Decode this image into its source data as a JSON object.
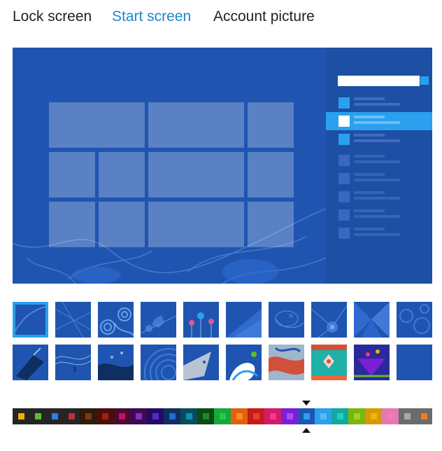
{
  "tabs": [
    {
      "label": "Lock screen",
      "active": false
    },
    {
      "label": "Start screen",
      "active": true
    },
    {
      "label": "Account picture",
      "active": false
    }
  ],
  "colors": {
    "accent": "#1e87c8",
    "background": "#1f55b0",
    "charm_bar": "#1d4fa4",
    "highlight": "#2aa0ee"
  },
  "patterns": {
    "selected_index": 0,
    "count": 20
  },
  "color_swatches": [
    {
      "bg": "#252525",
      "dot": "#f0b000"
    },
    {
      "bg": "#252525",
      "dot": "#5cbf2a"
    },
    {
      "bg": "#252525",
      "dot": "#2f7fe0"
    },
    {
      "bg": "#252525",
      "dot": "#c0303a"
    },
    {
      "bg": "#2e1a0e",
      "dot": "#7a3b10"
    },
    {
      "bg": "#4b0f0a",
      "dot": "#a02010"
    },
    {
      "bg": "#4a0a2e",
      "dot": "#c0106a"
    },
    {
      "bg": "#3a0b52",
      "dot": "#8a2cc0"
    },
    {
      "bg": "#220c63",
      "dot": "#5a28c8"
    },
    {
      "bg": "#0f2e62",
      "dot": "#1f6fd0"
    },
    {
      "bg": "#064c5e",
      "dot": "#0f8fa8"
    },
    {
      "bg": "#0b4a15",
      "dot": "#1a8a28"
    },
    {
      "bg": "#18a83a",
      "dot": "#27c94a"
    },
    {
      "bg": "#e0620e",
      "dot": "#ff8a20"
    },
    {
      "bg": "#c41b1b",
      "dot": "#f03a2a"
    },
    {
      "bg": "#d21a6a",
      "dot": "#f23a8a"
    },
    {
      "bg": "#7d1ed6",
      "dot": "#a94cf0"
    },
    {
      "bg": "#1f55b0",
      "dot": "#2aa0ee"
    },
    {
      "bg": "#2aa0ee",
      "dot": "#58b8f2"
    },
    {
      "bg": "#10a9a0",
      "dot": "#1fd0c2"
    },
    {
      "bg": "#7cb414",
      "dot": "#9cd41e"
    },
    {
      "bg": "#d69a00",
      "dot": "#f0b600"
    },
    {
      "bg": "#e57ab0",
      "dot": "#f07ac0"
    },
    {
      "bg": "#6b6b6b",
      "dot": "#a8a8a8"
    },
    {
      "bg": "#6b6b6b",
      "dot": "#f07c20"
    }
  ],
  "selected_color_index": 17
}
